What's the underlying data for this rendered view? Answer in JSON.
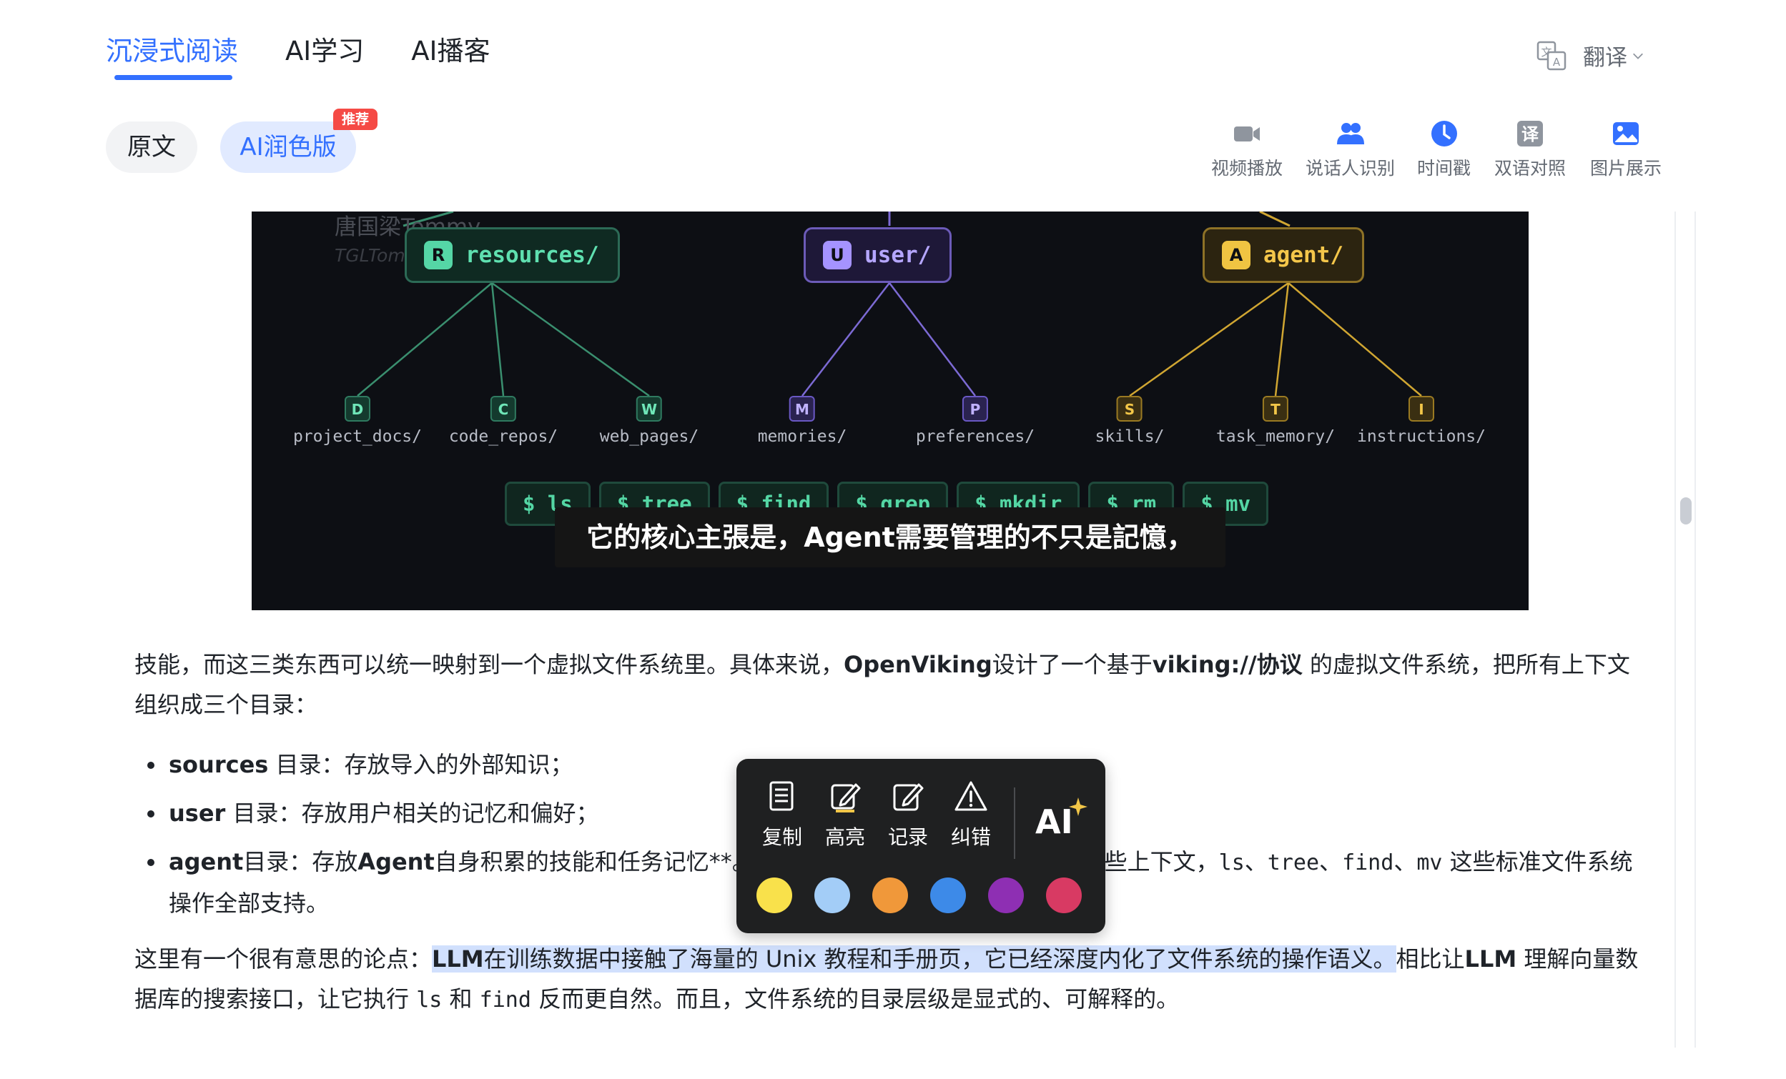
{
  "top_tabs": [
    "沉浸式阅读",
    "AI学习",
    "AI播客"
  ],
  "translate_label": "翻译",
  "version_tabs": {
    "original": "原文",
    "ai": "AI润色版",
    "badge": "推荐"
  },
  "tools": [
    {
      "label": "视频播放",
      "icon": "video-camera-icon"
    },
    {
      "label": "说话人识别",
      "icon": "speakers-icon"
    },
    {
      "label": "时间戳",
      "icon": "clock-icon"
    },
    {
      "label": "双语对照",
      "icon": "translate-box-icon"
    },
    {
      "label": "图片展示",
      "icon": "image-icon"
    }
  ],
  "video": {
    "watermark_cn": "唐国梁Tommy",
    "watermark_en": "TGLTommy",
    "nodes": [
      {
        "badge": "R",
        "label": "resources/"
      },
      {
        "badge": "U",
        "label": "user/"
      },
      {
        "badge": "A",
        "label": "agent/"
      }
    ],
    "leaves": [
      {
        "badge": "D",
        "label": "project_docs/"
      },
      {
        "badge": "C",
        "label": "code_repos/"
      },
      {
        "badge": "W",
        "label": "web_pages/"
      },
      {
        "badge": "M",
        "label": "memories/"
      },
      {
        "badge": "P",
        "label": "preferences/"
      },
      {
        "badge": "S",
        "label": "skills/"
      },
      {
        "badge": "T",
        "label": "task_memory/"
      },
      {
        "badge": "I",
        "label": "instructions/"
      }
    ],
    "commands": [
      "$ ls",
      "$ tree",
      "$ find",
      "$ grep",
      "$ mkdir",
      "$ rm",
      "$ mv"
    ],
    "subtitle": "它的核心主張是，Agent需要管理的不只是記憶，"
  },
  "article": {
    "p1_a": "技能，而这三类东西可以统一映射到一个虚拟文件系统里。具体来说，",
    "p1_b": "OpenViking",
    "p1_c": "设计了一个基于",
    "p1_d": "viking://协议",
    "p1_e": " 的虚拟文件系统，把所有上下文组织成三个目录：",
    "li1_b": "sources",
    "li1_t": " 目录：存放导入的外部知识；",
    "li2_b": "user",
    "li2_t": " 目录：存放用户相关的记忆和偏好；",
    "li3_b": "agent",
    "li3_t1": "目录：存放",
    "li3_b2": "Agent",
    "li3_t2": "自身积累的技能和任务记忆**。Agent 可以像操作文件一样操作这些上下文，",
    "li3_c1": "ls",
    "li3_s1": "、",
    "li3_c2": "tree",
    "li3_s2": "、",
    "li3_c3": "find",
    "li3_s3": "、",
    "li3_c4": "mv",
    "li3_t3": " 这些标准文件系统操作全部支持。",
    "p2_a": "这里有一个很有意思的论点：",
    "p2_hl_b": "LLM",
    "p2_hl_t": "在训练数据中接触了海量的 Unix 教程和手册页，它已经深度内化了文件系统的操作语义。",
    "p2_c": "相比让",
    "p2_d": "LLM",
    "p2_e": " 理解向量数据库的搜索接口，让它执行 ",
    "p2_c1": "ls",
    "p2_f": " 和 ",
    "p2_c2": "find",
    "p2_g": " 反而更自然。而且，文件系统的目录层级是显式的、可解释的。"
  },
  "popup": {
    "actions": [
      {
        "label": "复制",
        "icon": "copy-icon"
      },
      {
        "label": "高亮",
        "icon": "highlight-pen-icon"
      },
      {
        "label": "记录",
        "icon": "note-edit-icon"
      },
      {
        "label": "纠错",
        "icon": "warning-icon"
      }
    ],
    "ai_icon": "ai-sparkle-icon",
    "colors": [
      "#f9e14b",
      "#a3cdf7",
      "#f0983a",
      "#3d8ae8",
      "#8e2fb3",
      "#d83a63"
    ]
  }
}
